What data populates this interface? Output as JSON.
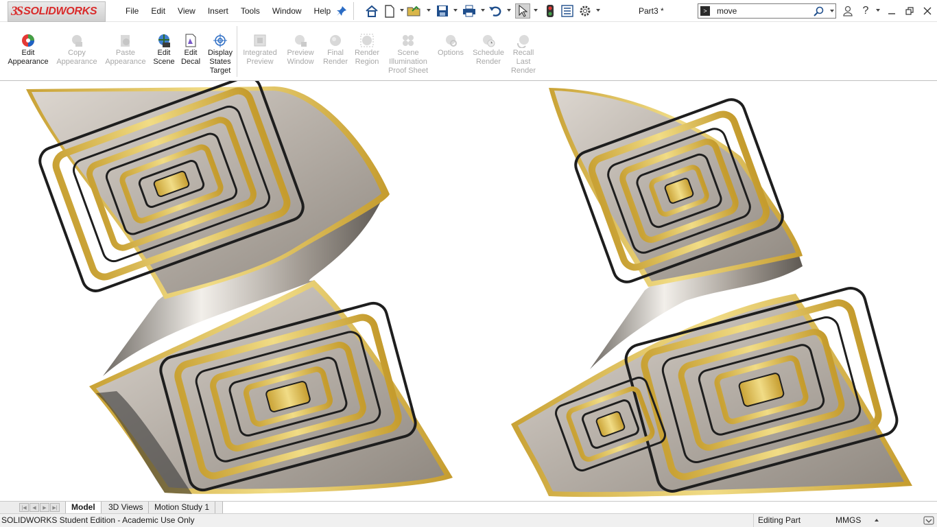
{
  "app": {
    "brand_prefix": "3S",
    "brand": "SOLIDWORKS",
    "doc_title": "Part3 *"
  },
  "menu": [
    "File",
    "Edit",
    "View",
    "Insert",
    "Tools",
    "Window",
    "Help"
  ],
  "quick_access_icons": [
    "home-icon",
    "new-document-icon",
    "open-folder-icon",
    "save-icon",
    "print-icon",
    "undo-icon",
    "select-arrow-icon",
    "rebuild-traffic-light-icon",
    "file-properties-icon",
    "options-gear-icon"
  ],
  "search": {
    "value": "move"
  },
  "ribbon": {
    "buttons": [
      {
        "label": "Edit\nAppearance",
        "enabled": true,
        "icon": "edit-appearance-icon"
      },
      {
        "label": "Copy\nAppearance",
        "enabled": false,
        "icon": "copy-appearance-icon"
      },
      {
        "label": "Paste\nAppearance",
        "enabled": false,
        "icon": "paste-appearance-icon"
      },
      {
        "label": "Edit\nScene",
        "enabled": true,
        "icon": "edit-scene-icon"
      },
      {
        "label": "Edit\nDecal",
        "enabled": true,
        "icon": "edit-decal-icon"
      },
      {
        "label": "Display\nStates\nTarget",
        "enabled": true,
        "icon": "display-states-target-icon"
      },
      {
        "label": "Integrated\nPreview",
        "enabled": false,
        "icon": "integrated-preview-icon"
      },
      {
        "label": "Preview\nWindow",
        "enabled": false,
        "icon": "preview-window-icon"
      },
      {
        "label": "Final\nRender",
        "enabled": false,
        "icon": "final-render-icon"
      },
      {
        "label": "Render\nRegion",
        "enabled": false,
        "icon": "render-region-icon"
      },
      {
        "label": "Scene\nIllumination\nProof Sheet",
        "enabled": false,
        "icon": "scene-illumination-icon"
      },
      {
        "label": "Options",
        "enabled": false,
        "icon": "render-options-icon"
      },
      {
        "label": "Schedule\nRender",
        "enabled": false,
        "icon": "schedule-render-icon"
      },
      {
        "label": "Recall\nLast\nRender",
        "enabled": false,
        "icon": "recall-last-render-icon"
      }
    ]
  },
  "bottom_tabs": {
    "model": "Model",
    "views3d": "3D Views",
    "motion": "Motion Study 1"
  },
  "status": {
    "message": "SOLIDWORKS Student Edition - Academic Use Only",
    "mode": "Editing Part",
    "units": "MMGS"
  },
  "colors": {
    "brand_red": "#d92b2b",
    "gold": "#e2c55a",
    "silver": "#b9b3ab",
    "engrave": "#1e1e1e"
  }
}
